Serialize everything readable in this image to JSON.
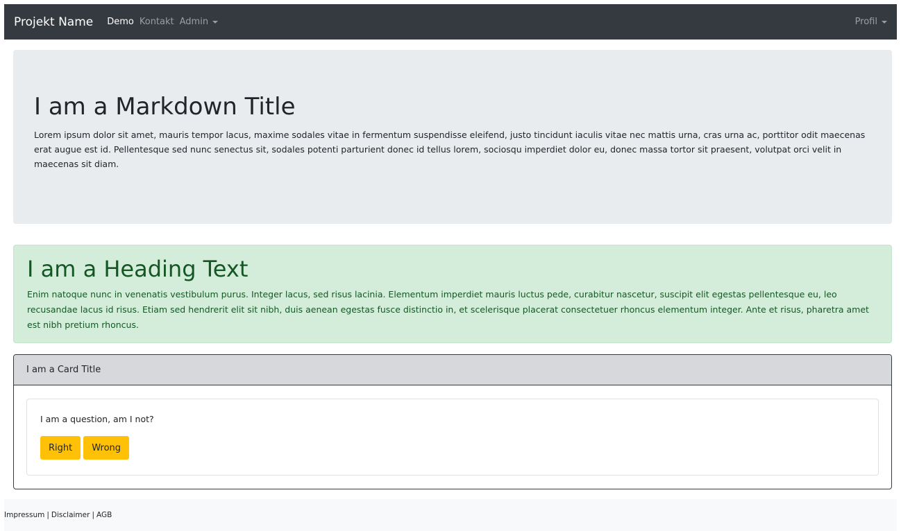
{
  "navbar": {
    "brand": "Projekt Name",
    "links": [
      {
        "label": "Demo"
      },
      {
        "label": "Kontakt"
      },
      {
        "label": "Admin"
      }
    ],
    "profile_label": "Profil"
  },
  "jumbotron": {
    "title": "I am a Markdown Title",
    "text": "Lorem ipsum dolor sit amet, mauris tempor lacus, maxime sodales vitae in fermentum suspendisse eleifend, justo tincidunt iaculis vitae nec mattis urna, cras urna ac, porttitor odit maecenas erat augue est id. Pellentesque sed nunc senectus sit, sodales potenti parturient donec id tellus lorem, sociosqu imperdiet dolor eu, donec massa tortor sit praesent, volutpat orci velit in maecenas sit diam."
  },
  "alert": {
    "heading": "I am a Heading Text",
    "text": "Enim natoque nunc in venenatis vestibulum purus. Integer lacus, sed risus lacinia. Elementum imperdiet mauris luctus pede, curabitur nascetur, suscipit elit egestas pellentesque eu, leo recusandae lacus id risus. Etiam sed hendrerit elit sit nibh, duis aenean egestas fusce distinctio in, et scelerisque placerat consectetuer rhoncus elementum integer. Ante et risus, pharetra amet est nibh pretium rhoncus."
  },
  "card": {
    "title": "I am a Card Title",
    "question": "I am a question, am I not?",
    "buttons": [
      {
        "label": "Right"
      },
      {
        "label": "Wrong"
      }
    ]
  },
  "footer": {
    "links": [
      "Impressum",
      "Disclaimer",
      "AGB"
    ],
    "separator": "|"
  },
  "colors": {
    "navbar_bg": "#343a40",
    "jumbotron_bg": "#e9ecef",
    "alert_bg": "#d4edda",
    "alert_text": "#155724",
    "button_bg": "#ffc107",
    "card_header_bg": "#d6d8db",
    "footer_bg": "#f8f9fa"
  }
}
